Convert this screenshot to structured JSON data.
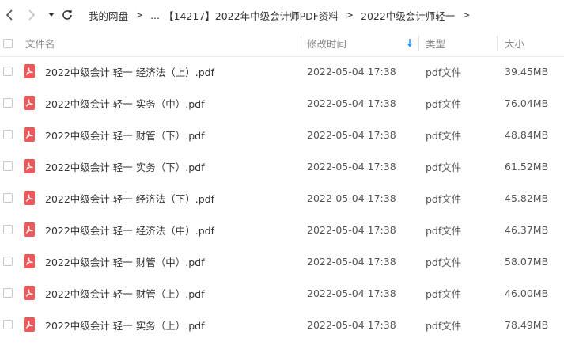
{
  "nav": {
    "back_icon": "chevron-left-icon",
    "forward_icon": "chevron-right-icon",
    "dropdown_icon": "caret-down-icon",
    "refresh_icon": "refresh-icon"
  },
  "breadcrumb": {
    "items": [
      "我的网盘",
      "...",
      "【14217】2022年中级会计师PDF资料",
      "2022中级会计师轻一"
    ],
    "separator": ">"
  },
  "columns": {
    "name": "文件名",
    "modified": "修改时间",
    "type": "类型",
    "size": "大小",
    "sort_icon": "arrow-down-icon",
    "sort_color": "#1e90ff"
  },
  "files": [
    {
      "name": "2022中级会计 轻一 经济法（上）.pdf",
      "modified": "2022-05-04 17:38",
      "type": "pdf文件",
      "size": "39.45MB"
    },
    {
      "name": "2022中级会计 轻一 实务（中）.pdf",
      "modified": "2022-05-04 17:38",
      "type": "pdf文件",
      "size": "76.04MB"
    },
    {
      "name": "2022中级会计 轻一 财管（下）.pdf",
      "modified": "2022-05-04 17:38",
      "type": "pdf文件",
      "size": "48.84MB"
    },
    {
      "name": "2022中级会计 轻一 实务（下）.pdf",
      "modified": "2022-05-04 17:38",
      "type": "pdf文件",
      "size": "61.52MB"
    },
    {
      "name": "2022中级会计 轻一 经济法（下）.pdf",
      "modified": "2022-05-04 17:38",
      "type": "pdf文件",
      "size": "45.82MB"
    },
    {
      "name": "2022中级会计 轻一 经济法（中）.pdf",
      "modified": "2022-05-04 17:38",
      "type": "pdf文件",
      "size": "46.37MB"
    },
    {
      "name": "2022中级会计 轻一 财管（中）.pdf",
      "modified": "2022-05-04 17:38",
      "type": "pdf文件",
      "size": "58.07MB"
    },
    {
      "name": "2022中级会计 轻一 财管（上）.pdf",
      "modified": "2022-05-04 17:38",
      "type": "pdf文件",
      "size": "46.00MB"
    },
    {
      "name": "2022中级会计 轻一 实务（上）.pdf",
      "modified": "2022-05-04 17:38",
      "type": "pdf文件",
      "size": "78.49MB"
    }
  ],
  "file_icon": "pdf-icon",
  "file_icon_color": "#ea5a5a"
}
